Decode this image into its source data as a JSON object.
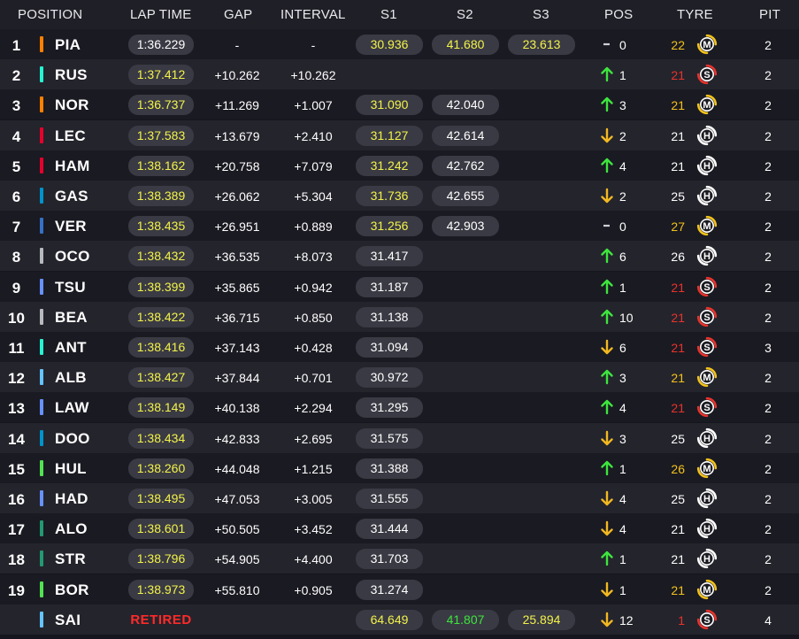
{
  "header": {
    "position": "POSITION",
    "lap_time": "LAP TIME",
    "gap": "GAP",
    "interval": "INTERVAL",
    "s1": "S1",
    "s2": "S2",
    "s3": "S3",
    "pos": "POS",
    "tyre": "TYRE",
    "pit": "PIT"
  },
  "colors": {
    "yellow_text": "#f2f24a",
    "green_text": "#3de53d",
    "red_text": "#ff2a2a",
    "arrow_up": "#3de53d",
    "arrow_down": "#f2b820",
    "tyre_medium": "#f2c21a",
    "tyre_soft": "#e8332c",
    "tyre_hard": "#ffffff"
  },
  "rows": [
    {
      "pos": "1",
      "team_color": "#ff8000",
      "driver": "PIA",
      "lap": "1:36.229",
      "lap_color": "white",
      "gap": "-",
      "interval": "-",
      "s1": "30.936",
      "s1c": "yellow",
      "s2": "41.680",
      "s2c": "yellow",
      "s3": "23.613",
      "s3c": "yellow",
      "pos_change": "0",
      "dir": "same",
      "tyre_laps": "22",
      "tyre_laps_color": "#f2c21a",
      "tyre": "M",
      "tyre_icon": "tyre-medium-icon",
      "pit": "2"
    },
    {
      "pos": "2",
      "team_color": "#27f4d2",
      "driver": "RUS",
      "lap": "1:37.412",
      "lap_color": "yellow",
      "gap": "+10.262",
      "interval": "+10.262",
      "s1": "",
      "s1c": "",
      "s2": "",
      "s2c": "",
      "s3": "",
      "s3c": "",
      "pos_change": "1",
      "dir": "up",
      "tyre_laps": "21",
      "tyre_laps_color": "#e8332c",
      "tyre": "S",
      "tyre_icon": "tyre-soft-icon",
      "pit": "2"
    },
    {
      "pos": "3",
      "team_color": "#ff8000",
      "driver": "NOR",
      "lap": "1:36.737",
      "lap_color": "yellow",
      "gap": "+11.269",
      "interval": "+1.007",
      "s1": "31.090",
      "s1c": "yellow",
      "s2": "42.040",
      "s2c": "white",
      "s3": "",
      "s3c": "",
      "pos_change": "3",
      "dir": "up",
      "tyre_laps": "21",
      "tyre_laps_color": "#f2c21a",
      "tyre": "M",
      "tyre_icon": "tyre-medium-icon",
      "pit": "2"
    },
    {
      "pos": "4",
      "team_color": "#e8002d",
      "driver": "LEC",
      "lap": "1:37.583",
      "lap_color": "yellow",
      "gap": "+13.679",
      "interval": "+2.410",
      "s1": "31.127",
      "s1c": "yellow",
      "s2": "42.614",
      "s2c": "white",
      "s3": "",
      "s3c": "",
      "pos_change": "2",
      "dir": "down",
      "tyre_laps": "21",
      "tyre_laps_color": "#ffffff",
      "tyre": "H",
      "tyre_icon": "tyre-hard-icon",
      "pit": "2"
    },
    {
      "pos": "5",
      "team_color": "#e8002d",
      "driver": "HAM",
      "lap": "1:38.162",
      "lap_color": "yellow",
      "gap": "+20.758",
      "interval": "+7.079",
      "s1": "31.242",
      "s1c": "yellow",
      "s2": "42.762",
      "s2c": "white",
      "s3": "",
      "s3c": "",
      "pos_change": "4",
      "dir": "up",
      "tyre_laps": "21",
      "tyre_laps_color": "#ffffff",
      "tyre": "H",
      "tyre_icon": "tyre-hard-icon",
      "pit": "2"
    },
    {
      "pos": "6",
      "team_color": "#0093cc",
      "driver": "GAS",
      "lap": "1:38.389",
      "lap_color": "yellow",
      "gap": "+26.062",
      "interval": "+5.304",
      "s1": "31.736",
      "s1c": "yellow",
      "s2": "42.655",
      "s2c": "white",
      "s3": "",
      "s3c": "",
      "pos_change": "2",
      "dir": "down",
      "tyre_laps": "25",
      "tyre_laps_color": "#ffffff",
      "tyre": "H",
      "tyre_icon": "tyre-hard-icon",
      "pit": "2"
    },
    {
      "pos": "7",
      "team_color": "#3671c6",
      "driver": "VER",
      "lap": "1:38.435",
      "lap_color": "yellow",
      "gap": "+26.951",
      "interval": "+0.889",
      "s1": "31.256",
      "s1c": "yellow",
      "s2": "42.903",
      "s2c": "white",
      "s3": "",
      "s3c": "",
      "pos_change": "0",
      "dir": "same",
      "tyre_laps": "27",
      "tyre_laps_color": "#f2c21a",
      "tyre": "M",
      "tyre_icon": "tyre-medium-icon",
      "pit": "2"
    },
    {
      "pos": "8",
      "team_color": "#b6babd",
      "driver": "OCO",
      "lap": "1:38.432",
      "lap_color": "yellow",
      "gap": "+36.535",
      "interval": "+8.073",
      "s1": "31.417",
      "s1c": "white",
      "s2": "",
      "s2c": "",
      "s3": "",
      "s3c": "",
      "pos_change": "6",
      "dir": "up",
      "tyre_laps": "26",
      "tyre_laps_color": "#ffffff",
      "tyre": "H",
      "tyre_icon": "tyre-hard-icon",
      "pit": "2"
    },
    {
      "pos": "9",
      "team_color": "#6692ff",
      "driver": "TSU",
      "lap": "1:38.399",
      "lap_color": "yellow",
      "gap": "+35.865",
      "interval": "+0.942",
      "s1": "31.187",
      "s1c": "white",
      "s2": "",
      "s2c": "",
      "s3": "",
      "s3c": "",
      "pos_change": "1",
      "dir": "up",
      "tyre_laps": "21",
      "tyre_laps_color": "#e8332c",
      "tyre": "S",
      "tyre_icon": "tyre-soft-icon",
      "pit": "2"
    },
    {
      "pos": "10",
      "team_color": "#b6babd",
      "driver": "BEA",
      "lap": "1:38.422",
      "lap_color": "yellow",
      "gap": "+36.715",
      "interval": "+0.850",
      "s1": "31.138",
      "s1c": "white",
      "s2": "",
      "s2c": "",
      "s3": "",
      "s3c": "",
      "pos_change": "10",
      "dir": "up",
      "tyre_laps": "21",
      "tyre_laps_color": "#e8332c",
      "tyre": "S",
      "tyre_icon": "tyre-soft-icon",
      "pit": "2"
    },
    {
      "pos": "11",
      "team_color": "#27f4d2",
      "driver": "ANT",
      "lap": "1:38.416",
      "lap_color": "yellow",
      "gap": "+37.143",
      "interval": "+0.428",
      "s1": "31.094",
      "s1c": "white",
      "s2": "",
      "s2c": "",
      "s3": "",
      "s3c": "",
      "pos_change": "6",
      "dir": "down",
      "tyre_laps": "21",
      "tyre_laps_color": "#e8332c",
      "tyre": "S",
      "tyre_icon": "tyre-soft-icon",
      "pit": "3"
    },
    {
      "pos": "12",
      "team_color": "#64c4ff",
      "driver": "ALB",
      "lap": "1:38.427",
      "lap_color": "yellow",
      "gap": "+37.844",
      "interval": "+0.701",
      "s1": "30.972",
      "s1c": "white",
      "s2": "",
      "s2c": "",
      "s3": "",
      "s3c": "",
      "pos_change": "3",
      "dir": "up",
      "tyre_laps": "21",
      "tyre_laps_color": "#f2c21a",
      "tyre": "M",
      "tyre_icon": "tyre-medium-icon",
      "pit": "2"
    },
    {
      "pos": "13",
      "team_color": "#6692ff",
      "driver": "LAW",
      "lap": "1:38.149",
      "lap_color": "yellow",
      "gap": "+40.138",
      "interval": "+2.294",
      "s1": "31.295",
      "s1c": "white",
      "s2": "",
      "s2c": "",
      "s3": "",
      "s3c": "",
      "pos_change": "4",
      "dir": "up",
      "tyre_laps": "21",
      "tyre_laps_color": "#e8332c",
      "tyre": "S",
      "tyre_icon": "tyre-soft-icon",
      "pit": "2"
    },
    {
      "pos": "14",
      "team_color": "#0093cc",
      "driver": "DOO",
      "lap": "1:38.434",
      "lap_color": "yellow",
      "gap": "+42.833",
      "interval": "+2.695",
      "s1": "31.575",
      "s1c": "white",
      "s2": "",
      "s2c": "",
      "s3": "",
      "s3c": "",
      "pos_change": "3",
      "dir": "down",
      "tyre_laps": "25",
      "tyre_laps_color": "#ffffff",
      "tyre": "H",
      "tyre_icon": "tyre-hard-icon",
      "pit": "2"
    },
    {
      "pos": "15",
      "team_color": "#52e252",
      "driver": "HUL",
      "lap": "1:38.260",
      "lap_color": "yellow",
      "gap": "+44.048",
      "interval": "+1.215",
      "s1": "31.388",
      "s1c": "white",
      "s2": "",
      "s2c": "",
      "s3": "",
      "s3c": "",
      "pos_change": "1",
      "dir": "up",
      "tyre_laps": "26",
      "tyre_laps_color": "#f2c21a",
      "tyre": "M",
      "tyre_icon": "tyre-medium-icon",
      "pit": "2"
    },
    {
      "pos": "16",
      "team_color": "#6692ff",
      "driver": "HAD",
      "lap": "1:38.495",
      "lap_color": "yellow",
      "gap": "+47.053",
      "interval": "+3.005",
      "s1": "31.555",
      "s1c": "white",
      "s2": "",
      "s2c": "",
      "s3": "",
      "s3c": "",
      "pos_change": "4",
      "dir": "down",
      "tyre_laps": "25",
      "tyre_laps_color": "#ffffff",
      "tyre": "H",
      "tyre_icon": "tyre-hard-icon",
      "pit": "2"
    },
    {
      "pos": "17",
      "team_color": "#229971",
      "driver": "ALO",
      "lap": "1:38.601",
      "lap_color": "yellow",
      "gap": "+50.505",
      "interval": "+3.452",
      "s1": "31.444",
      "s1c": "white",
      "s2": "",
      "s2c": "",
      "s3": "",
      "s3c": "",
      "pos_change": "4",
      "dir": "down",
      "tyre_laps": "21",
      "tyre_laps_color": "#ffffff",
      "tyre": "H",
      "tyre_icon": "tyre-hard-icon",
      "pit": "2"
    },
    {
      "pos": "18",
      "team_color": "#229971",
      "driver": "STR",
      "lap": "1:38.796",
      "lap_color": "yellow",
      "gap": "+54.905",
      "interval": "+4.400",
      "s1": "31.703",
      "s1c": "white",
      "s2": "",
      "s2c": "",
      "s3": "",
      "s3c": "",
      "pos_change": "1",
      "dir": "up",
      "tyre_laps": "21",
      "tyre_laps_color": "#ffffff",
      "tyre": "H",
      "tyre_icon": "tyre-hard-icon",
      "pit": "2"
    },
    {
      "pos": "19",
      "team_color": "#52e252",
      "driver": "BOR",
      "lap": "1:38.973",
      "lap_color": "yellow",
      "gap": "+55.810",
      "interval": "+0.905",
      "s1": "31.274",
      "s1c": "white",
      "s2": "",
      "s2c": "",
      "s3": "",
      "s3c": "",
      "pos_change": "1",
      "dir": "down",
      "tyre_laps": "21",
      "tyre_laps_color": "#f2c21a",
      "tyre": "M",
      "tyre_icon": "tyre-medium-icon",
      "pit": "2"
    },
    {
      "pos": "",
      "team_color": "#64c4ff",
      "driver": "SAI",
      "lap": "RETIRED",
      "lap_color": "retired",
      "gap": "",
      "interval": "",
      "s1": "64.649",
      "s1c": "yellow",
      "s2": "41.807",
      "s2c": "green",
      "s3": "25.894",
      "s3c": "yellow",
      "pos_change": "12",
      "dir": "down",
      "tyre_laps": "1",
      "tyre_laps_color": "#e8332c",
      "tyre": "S",
      "tyre_icon": "tyre-soft-icon",
      "pit": "4"
    }
  ]
}
